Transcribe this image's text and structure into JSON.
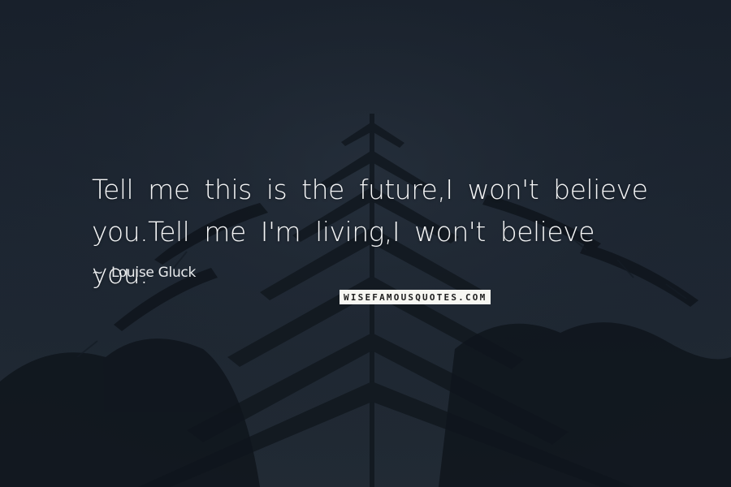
{
  "quote": {
    "text": "Tell me this is the future,I won't believe you.Tell me I'm living,I won't believe you.",
    "author_prefix": "~",
    "author": "Louise Gluck"
  },
  "watermark": {
    "text": "WISEFAMOUSQUOTES.COM"
  },
  "colors": {
    "sky": "#1c2430",
    "foliage": "#111820",
    "text": "#f4f5f6",
    "watermark_bg": "#f7f7f2"
  }
}
